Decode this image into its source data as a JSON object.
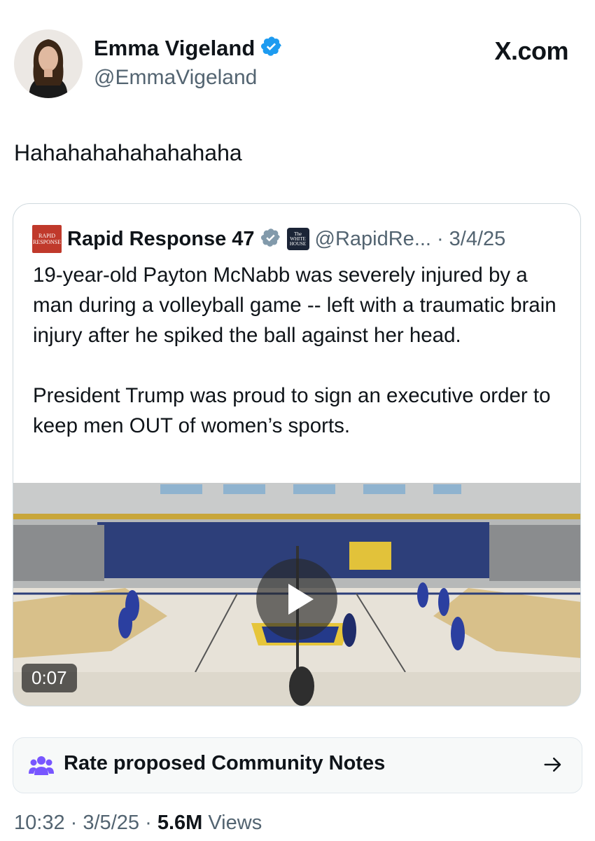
{
  "author": {
    "display_name": "Emma Vigeland",
    "handle": "@EmmaVigeland",
    "verified": true
  },
  "site_label": "X.com",
  "tweet_text": "Hahahahahahahahaha",
  "quoted_tweet": {
    "account_name": "Rapid Response 47",
    "verified": true,
    "logo_text": [
      "RAPID",
      "RESPONSE"
    ],
    "affiliate_badge_text": [
      "The",
      "WHITE",
      "HOUSE"
    ],
    "handle": "@RapidRe...",
    "separator": "·",
    "date": "3/4/25",
    "body": "19-year-old Payton McNabb was severely injured by a man during a volleyball game -- left with a traumatic brain injury after he spiked the ball against her head.\n\nPresident Trump was proud to sign an executive order to keep men OUT of women’s sports.",
    "video": {
      "duration": "0:07"
    }
  },
  "community_notes": {
    "label": "Rate proposed Community Notes"
  },
  "meta": {
    "time": "10:32",
    "sep1": "·",
    "date": "3/5/25",
    "sep2": "·",
    "views_count": "5.6M",
    "views_label": "Views"
  },
  "colors": {
    "verified_blue": "#1d9bf0",
    "verified_gray": "#829aab",
    "secondary_text": "#536471",
    "community_notes_purple": "#7856ff"
  },
  "icons": [
    "verified-badge-icon",
    "play-icon",
    "community-notes-icon",
    "arrow-right-icon"
  ]
}
